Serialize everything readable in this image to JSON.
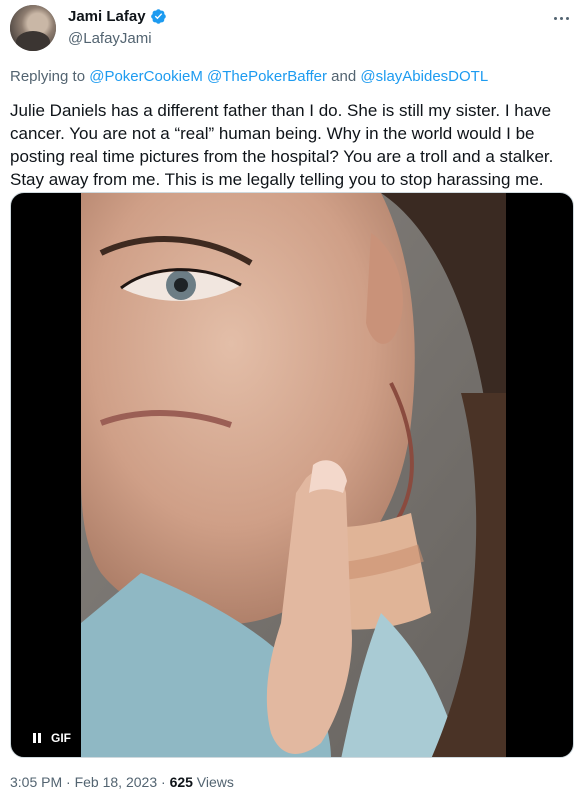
{
  "author": {
    "display_name": "Jami Lafay",
    "handle": "@LafayJami",
    "verified": true
  },
  "reply": {
    "prefix": "Replying to ",
    "mention1": "@PokerCookieM",
    "mention2": "@ThePokerBaffer",
    "and": " and ",
    "mention3": "@slayAbidesDOTL"
  },
  "tweet": {
    "text": "Julie Daniels has a different father than I do. She is still my sister. I have cancer. You are not a “real” human being. Why in the world would I be posting real time pictures from the hospital? You are a troll and a stalker. Stay away from me. This is me legally telling you to stop harassing me."
  },
  "media": {
    "badge_label": "GIF",
    "icons": [
      "pause-icon"
    ]
  },
  "footer": {
    "time": "3:05 PM",
    "sep1": " · ",
    "date": "Feb 18, 2023",
    "sep2": " · ",
    "views_count": "625",
    "views_label": " Views"
  },
  "colors": {
    "link": "#1d9bf0",
    "secondary_text": "#536471",
    "primary_text": "#0f1419",
    "verified": "#1d9bf0"
  }
}
